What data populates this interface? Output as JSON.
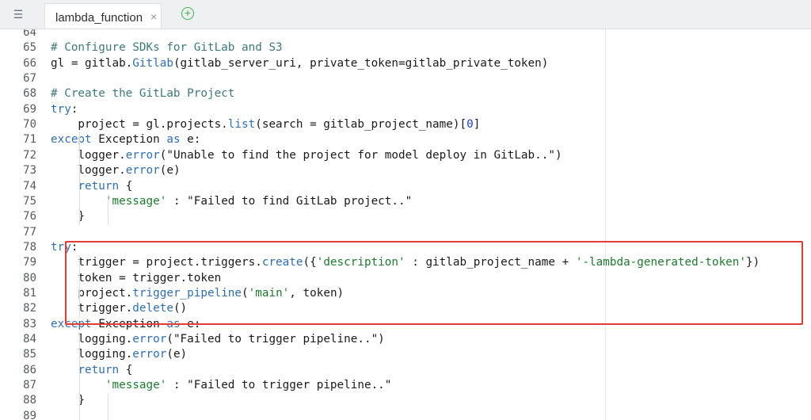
{
  "tabbar": {
    "tab_label": "lambda_function",
    "close_glyph": "×",
    "add_glyph": "+",
    "icons": {
      "sidebar_toggle": "file-tree-icon",
      "close": "close-icon",
      "add": "add-tab-icon"
    }
  },
  "colors": {
    "keyword": "#2f6fb5",
    "comment": "#3f7a7a",
    "string": "#1f7a2f",
    "number": "#1b3fd0",
    "highlight_box": "#e53b35",
    "add_tab": "#3db54a"
  },
  "editor": {
    "highlighted_lines": "78-82",
    "lines": [
      {
        "n": "64",
        "segs": []
      },
      {
        "n": "65",
        "segs": [
          {
            "c": "cm",
            "t": "# Configure SDKs for GitLab and S3"
          }
        ]
      },
      {
        "n": "66",
        "segs": [
          {
            "c": "",
            "t": "gl = gitlab."
          },
          {
            "c": "fn",
            "t": "Gitlab"
          },
          {
            "c": "",
            "t": "(gitlab_server_uri, private_token=gitlab_private_token)"
          }
        ]
      },
      {
        "n": "67",
        "segs": []
      },
      {
        "n": "68",
        "segs": [
          {
            "c": "cm",
            "t": "# Create the GitLab Project"
          }
        ]
      },
      {
        "n": "69",
        "segs": [
          {
            "c": "kw",
            "t": "try"
          },
          {
            "c": "",
            "t": ":"
          }
        ]
      },
      {
        "n": "70",
        "segs": [
          {
            "c": "",
            "t": "    project = gl.projects."
          },
          {
            "c": "fn",
            "t": "list"
          },
          {
            "c": "",
            "t": "(search = gitlab_project_name)["
          },
          {
            "c": "num",
            "t": "0"
          },
          {
            "c": "",
            "t": "]"
          }
        ]
      },
      {
        "n": "71",
        "segs": [
          {
            "c": "kw",
            "t": "except"
          },
          {
            "c": "",
            "t": " Exception "
          },
          {
            "c": "kw",
            "t": "as"
          },
          {
            "c": "",
            "t": " e:"
          }
        ]
      },
      {
        "n": "72",
        "segs": [
          {
            "c": "",
            "t": "    logger."
          },
          {
            "c": "fn",
            "t": "error"
          },
          {
            "c": "",
            "t": "(\"Unable to find the project for model deploy in GitLab..\")"
          }
        ]
      },
      {
        "n": "73",
        "segs": [
          {
            "c": "",
            "t": "    logger."
          },
          {
            "c": "fn",
            "t": "error"
          },
          {
            "c": "",
            "t": "(e)"
          }
        ]
      },
      {
        "n": "74",
        "segs": [
          {
            "c": "",
            "t": "    "
          },
          {
            "c": "kw",
            "t": "return"
          },
          {
            "c": "",
            "t": " {"
          }
        ]
      },
      {
        "n": "75",
        "segs": [
          {
            "c": "",
            "t": "        "
          },
          {
            "c": "st",
            "t": "'message'"
          },
          {
            "c": "",
            "t": " : \"Failed to find GitLab project..\""
          }
        ]
      },
      {
        "n": "76",
        "segs": [
          {
            "c": "",
            "t": "    }"
          }
        ]
      },
      {
        "n": "77",
        "segs": []
      },
      {
        "n": "78",
        "segs": [
          {
            "c": "kw",
            "t": "try"
          },
          {
            "c": "",
            "t": ":"
          }
        ]
      },
      {
        "n": "79",
        "segs": [
          {
            "c": "",
            "t": "    trigger = project.triggers."
          },
          {
            "c": "fn",
            "t": "create"
          },
          {
            "c": "",
            "t": "({"
          },
          {
            "c": "st",
            "t": "'description'"
          },
          {
            "c": "",
            "t": " : gitlab_project_name + "
          },
          {
            "c": "st",
            "t": "'-lambda-generated-token'"
          },
          {
            "c": "",
            "t": "})"
          }
        ]
      },
      {
        "n": "80",
        "segs": [
          {
            "c": "",
            "t": "    token = trigger.token"
          }
        ]
      },
      {
        "n": "81",
        "segs": [
          {
            "c": "",
            "t": "    project."
          },
          {
            "c": "fn",
            "t": "trigger_pipeline"
          },
          {
            "c": "",
            "t": "("
          },
          {
            "c": "st",
            "t": "'main'"
          },
          {
            "c": "",
            "t": ", token)"
          }
        ]
      },
      {
        "n": "82",
        "segs": [
          {
            "c": "",
            "t": "    trigger."
          },
          {
            "c": "fn",
            "t": "delete"
          },
          {
            "c": "",
            "t": "()"
          }
        ]
      },
      {
        "n": "83",
        "segs": [
          {
            "c": "kw",
            "t": "except"
          },
          {
            "c": "",
            "t": " Exception "
          },
          {
            "c": "kw",
            "t": "as"
          },
          {
            "c": "",
            "t": " e:"
          }
        ]
      },
      {
        "n": "84",
        "segs": [
          {
            "c": "",
            "t": "    logging."
          },
          {
            "c": "fn",
            "t": "error"
          },
          {
            "c": "",
            "t": "(\"Failed to trigger pipeline..\")"
          }
        ]
      },
      {
        "n": "85",
        "segs": [
          {
            "c": "",
            "t": "    logging."
          },
          {
            "c": "fn",
            "t": "error"
          },
          {
            "c": "",
            "t": "(e)"
          }
        ]
      },
      {
        "n": "86",
        "segs": [
          {
            "c": "",
            "t": "    "
          },
          {
            "c": "kw",
            "t": "return"
          },
          {
            "c": "",
            "t": " {"
          }
        ]
      },
      {
        "n": "87",
        "segs": [
          {
            "c": "",
            "t": "        "
          },
          {
            "c": "st",
            "t": "'message'"
          },
          {
            "c": "",
            "t": " : \"Failed to trigger pipeline..\""
          }
        ]
      },
      {
        "n": "88",
        "segs": [
          {
            "c": "",
            "t": "    }"
          }
        ]
      },
      {
        "n": "89",
        "segs": []
      }
    ]
  }
}
